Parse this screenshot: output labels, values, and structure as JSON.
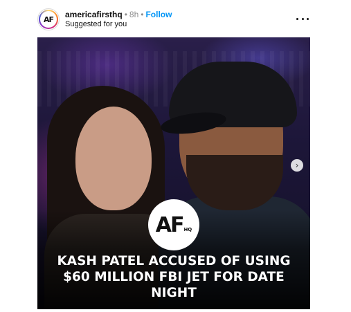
{
  "post": {
    "username": "americafirsthq",
    "separator": "•",
    "time": "8h",
    "follow_label": "Follow",
    "subtitle": "Suggested for you",
    "avatar_text": "AF",
    "more_icon": "ellipsis-icon",
    "image": {
      "logo_text": "AF",
      "logo_subtext": "HQ",
      "headline": "KASH PATEL ACCUSED OF USING $60 MILLION FBI JET FOR DATE NIGHT",
      "next_arrow": "›"
    }
  }
}
